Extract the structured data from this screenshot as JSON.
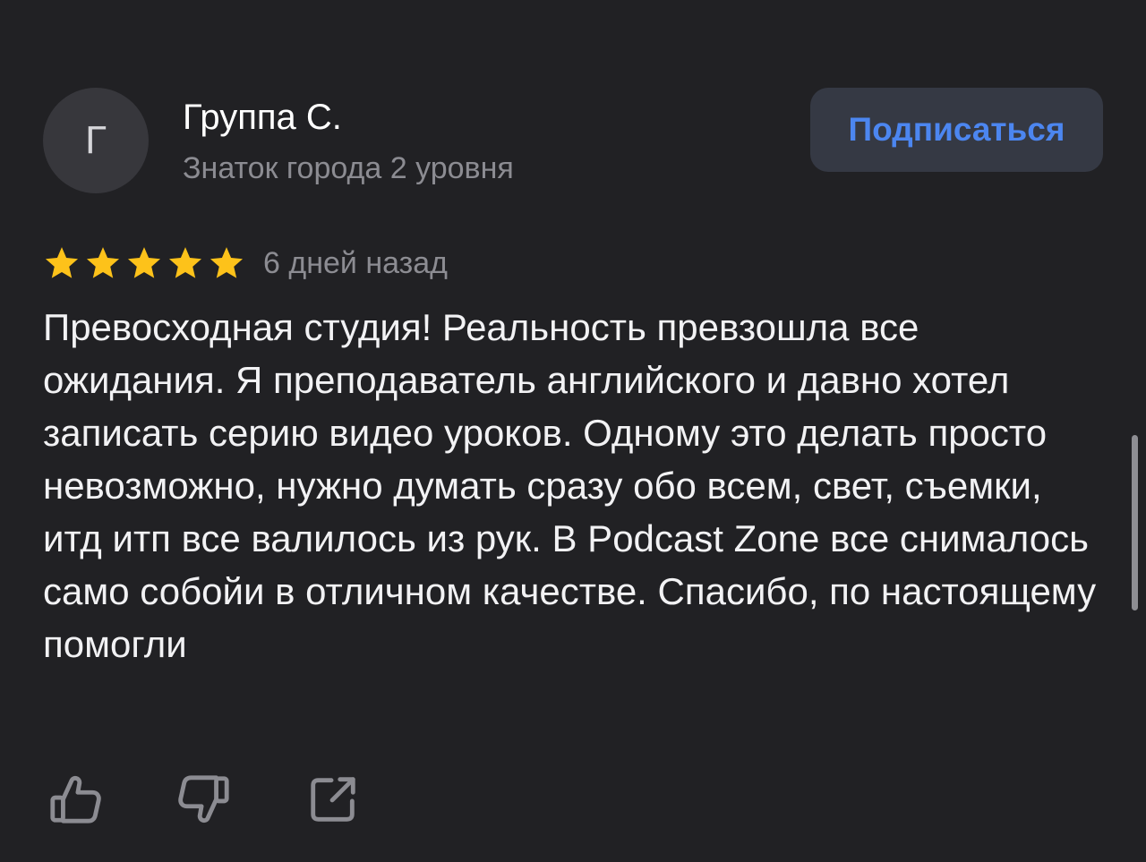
{
  "author": {
    "avatar_letter": "Г",
    "name": "Группа С.",
    "level": "Знаток города 2 уровня"
  },
  "subscribe_button": {
    "label": "Подписаться"
  },
  "review": {
    "rating": 5,
    "rating_max": 5,
    "star_color": "#fdc21a",
    "date": "6 дней назад",
    "text": "Превосходная студия! Реальность превзошла все ожидания. Я преподаватель английского и давно хотел записать серию видео уроков. Одному это делать просто невозможно, нужно думать сразу обо всем, свет, съемки, итд итп все валилось из рук. В Podcast Zone все снималось само собойи в отличном качестве. Спасибо, по настоящему помогли"
  },
  "actions": [
    {
      "icon": "thumbs-up-icon"
    },
    {
      "icon": "thumbs-down-icon"
    },
    {
      "icon": "share-icon"
    }
  ],
  "colors": {
    "background": "#212124",
    "accent": "#4c86f0",
    "button_bg": "#353944"
  }
}
